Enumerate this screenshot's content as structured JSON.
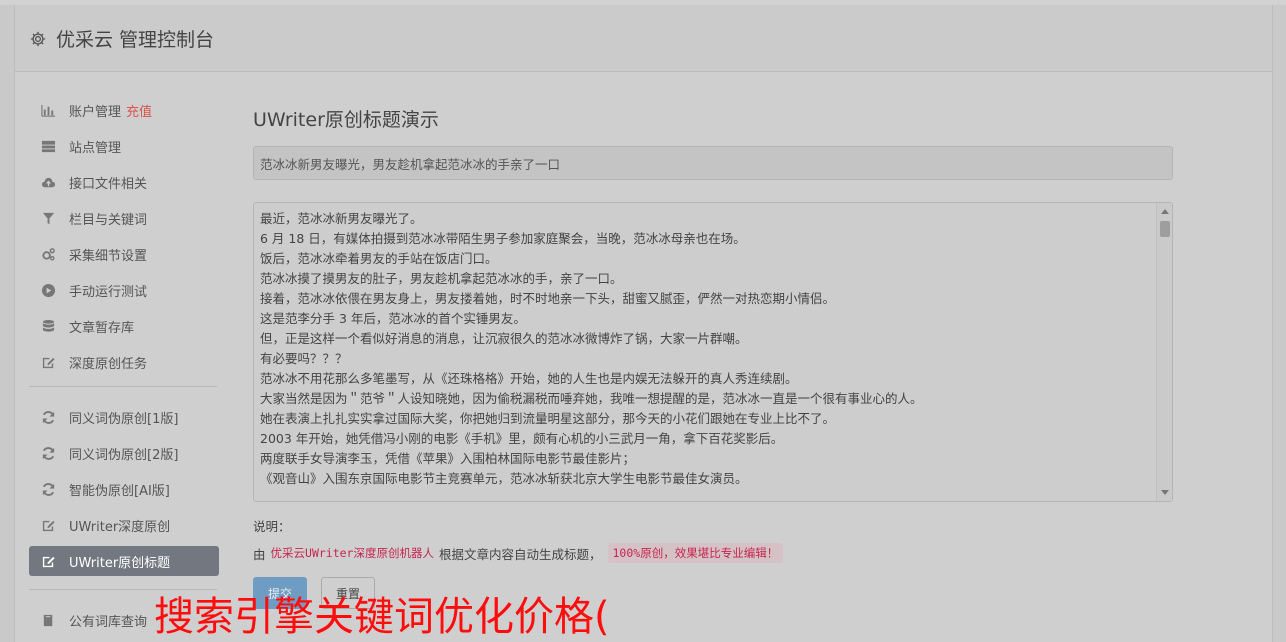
{
  "app": {
    "title": "优采云 管理控制台"
  },
  "sidebar": {
    "items": [
      {
        "label": "账户管理",
        "badge": "充值",
        "icon": "bar-chart-icon"
      },
      {
        "label": "站点管理",
        "icon": "server-icon"
      },
      {
        "label": "接口文件相关",
        "icon": "cloud-upload-icon"
      },
      {
        "label": "栏目与关键词",
        "icon": "filter-icon"
      },
      {
        "label": "采集细节设置",
        "icon": "gears-icon"
      },
      {
        "label": "手动运行测试",
        "icon": "play-circle-icon"
      },
      {
        "label": "文章暂存库",
        "icon": "database-icon"
      },
      {
        "label": "深度原创任务",
        "icon": "edit-icon"
      },
      {
        "label": "同义词伪原创[1版]",
        "icon": "refresh-icon"
      },
      {
        "label": "同义词伪原创[2版]",
        "icon": "refresh-icon"
      },
      {
        "label": "智能伪原创[AI版]",
        "icon": "refresh-icon"
      },
      {
        "label": "UWriter深度原创",
        "icon": "edit-icon"
      },
      {
        "label": "UWriter原创标题",
        "icon": "edit-icon",
        "active": true
      },
      {
        "label": "公有词库查询",
        "icon": "book-icon"
      }
    ]
  },
  "main": {
    "title": "UWriter原创标题演示",
    "title_value": "范冰冰新男友曝光，男友趁机拿起范冰冰的手亲了一口",
    "content_lines": [
      "最近，范冰冰新男友曝光了。",
      "6 月 18 日，有媒体拍摄到范冰冰带陌生男子参加家庭聚会，当晚，范冰冰母亲也在场。",
      "饭后，范冰冰牵着男友的手站在饭店门口。",
      "范冰冰摸了摸男友的肚子，男友趁机拿起范冰冰的手，亲了一口。",
      "接着，范冰冰依偎在男友身上，男友搂着她，时不时地亲一下头，甜蜜又腻歪，俨然一对热恋期小情侣。",
      "这是范李分手 3 年后，范冰冰的首个实锤男友。",
      "但，正是这样一个看似好消息的消息，让沉寂很久的范冰冰微博炸了锅，大家一片群嘲。",
      "有必要吗？？？",
      "范冰冰不用花那么多笔墨写，从《还珠格格》开始，她的人生也是内娱无法躲开的真人秀连续剧。",
      "大家当然是因为＂范爷＂人设知晓她，因为偷税漏税而唾弃她，我唯一想提醒的是，范冰冰一直是一个很有事业心的人。",
      "她在表演上扎扎实实拿过国际大奖，你把她归到流量明星这部分，那今天的小花们跟她在专业上比不了。",
      "2003 年开始，她凭借冯小刚的电影《手机》里，颇有心机的小三武月一角，拿下百花奖影后。",
      "两度联手女导演李玉，凭借《苹果》入围柏林国际电影节最佳影片；",
      "《观音山》入围东京国际电影节主竞赛单元，范冰冰斩获北京大学生电影节最佳女演员。"
    ],
    "note_label": "说明：",
    "note_prefix": "由",
    "note_link": "优采云UWriter深度原创机器人",
    "note_mid": "根据文章内容自动生成标题，",
    "note_code": "100%原创，效果堪比专业编辑！",
    "submit_label": "提交",
    "reset_label": "重置"
  },
  "overlay_text": "搜索引擎关键词优化价格("
}
